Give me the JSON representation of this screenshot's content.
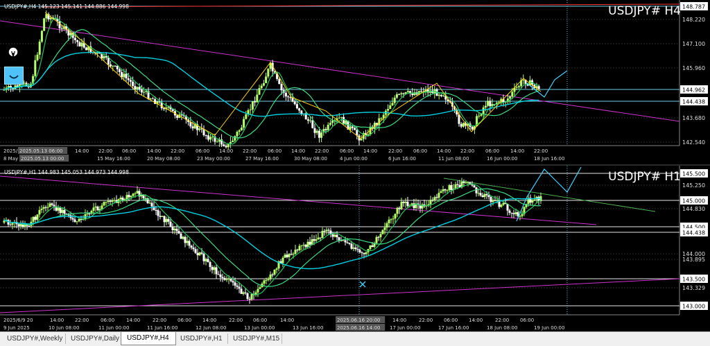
{
  "top": {
    "info": "USDJPY#,H4  145.123 145.141 144.886 144.998",
    "symbol": "USDJPY# H4",
    "prices": [
      {
        "text": "148.787",
        "highlight": true
      },
      {
        "text": "148.220"
      },
      {
        "text": "147.100"
      },
      {
        "text": "145.960"
      },
      {
        "text": "144.962",
        "highlight": true
      },
      {
        "text": "144.438",
        "highlight": true
      },
      {
        "text": "143.680"
      },
      {
        "text": "142.540"
      }
    ],
    "time_upper": [
      "2025/5/8 2",
      "2025.05.13 06:00",
      "14:00",
      "22:00",
      "06:00",
      "14:00",
      "22:00",
      "06:00",
      "14:00",
      "22:00",
      "06:00",
      "14:00",
      "22:00",
      "06:00",
      "14:00",
      "22:00",
      "06:00",
      "14:00",
      "22:00",
      "06:00",
      "14:00",
      "22:00"
    ],
    "time_lower": [
      "8 May 202",
      "2025.05.13 00:00",
      "15 May 16:00",
      "20 May 08:00",
      "23 May 00:00",
      "27 May 16:00",
      "30 May 08:00",
      "4 Jun 00:00",
      "6 Jun 16:00",
      "11 Jun 08:00",
      "16 Jun 00:00",
      "18 Jun 16:00"
    ]
  },
  "bottom": {
    "info": "USDJPY#,H1  144.983 145.053 144.973 144.998",
    "symbol": "USDJPY# H1",
    "prices": [
      {
        "text": "145.500",
        "highlight": true
      },
      {
        "text": "145.250"
      },
      {
        "text": "145.000",
        "highlight": true
      },
      {
        "text": "144.830"
      },
      {
        "text": "144.500",
        "highlight": true
      },
      {
        "text": "144.438",
        "highlight": true
      },
      {
        "text": "144.000"
      },
      {
        "text": "143.895"
      },
      {
        "text": "143.500",
        "highlight": true
      },
      {
        "text": "143.329"
      },
      {
        "text": "143.000",
        "highlight": true
      }
    ],
    "time_upper": [
      "2025/6/9 20",
      "14:00",
      "22:00",
      "06:00",
      "14:00",
      "22:00",
      "06:00",
      "14:00",
      "22:00",
      "06:00",
      "14:00",
      "2025.06.16 20:00",
      "14:00",
      "22:00",
      "06:00",
      "14:00",
      "22:00",
      "06:00"
    ],
    "time_lower": [
      "9 Jun 2025",
      "10 Jun 08:00",
      "11 Jun 00:00",
      "11 Jun 16:00",
      "12 Jun 08:00",
      "13 Jun 00:00",
      "13 Jun 16:00",
      "2025.06.16 14:00",
      "17 Jun 00:00",
      "17 Jun 16:00",
      "18 Jun 08:00",
      "19 Jun 00:00"
    ]
  },
  "tabs": [
    "USDJPY#,Weekly",
    "USDJPY#,Daily",
    "USDJPY#,H4",
    "USDJPY#,H1",
    "USDJPY#,M15"
  ],
  "active_tab": 2,
  "colors": {
    "bull": "#b6ff6b",
    "bear": "#ffffff",
    "ma_fast": "#22c55e",
    "ma_mid": "#3ddc84",
    "ma_slow": "#00d0e0",
    "zigzag": "#ffd400",
    "trend": "#cc33cc",
    "hline": "#7fe5ff"
  }
}
